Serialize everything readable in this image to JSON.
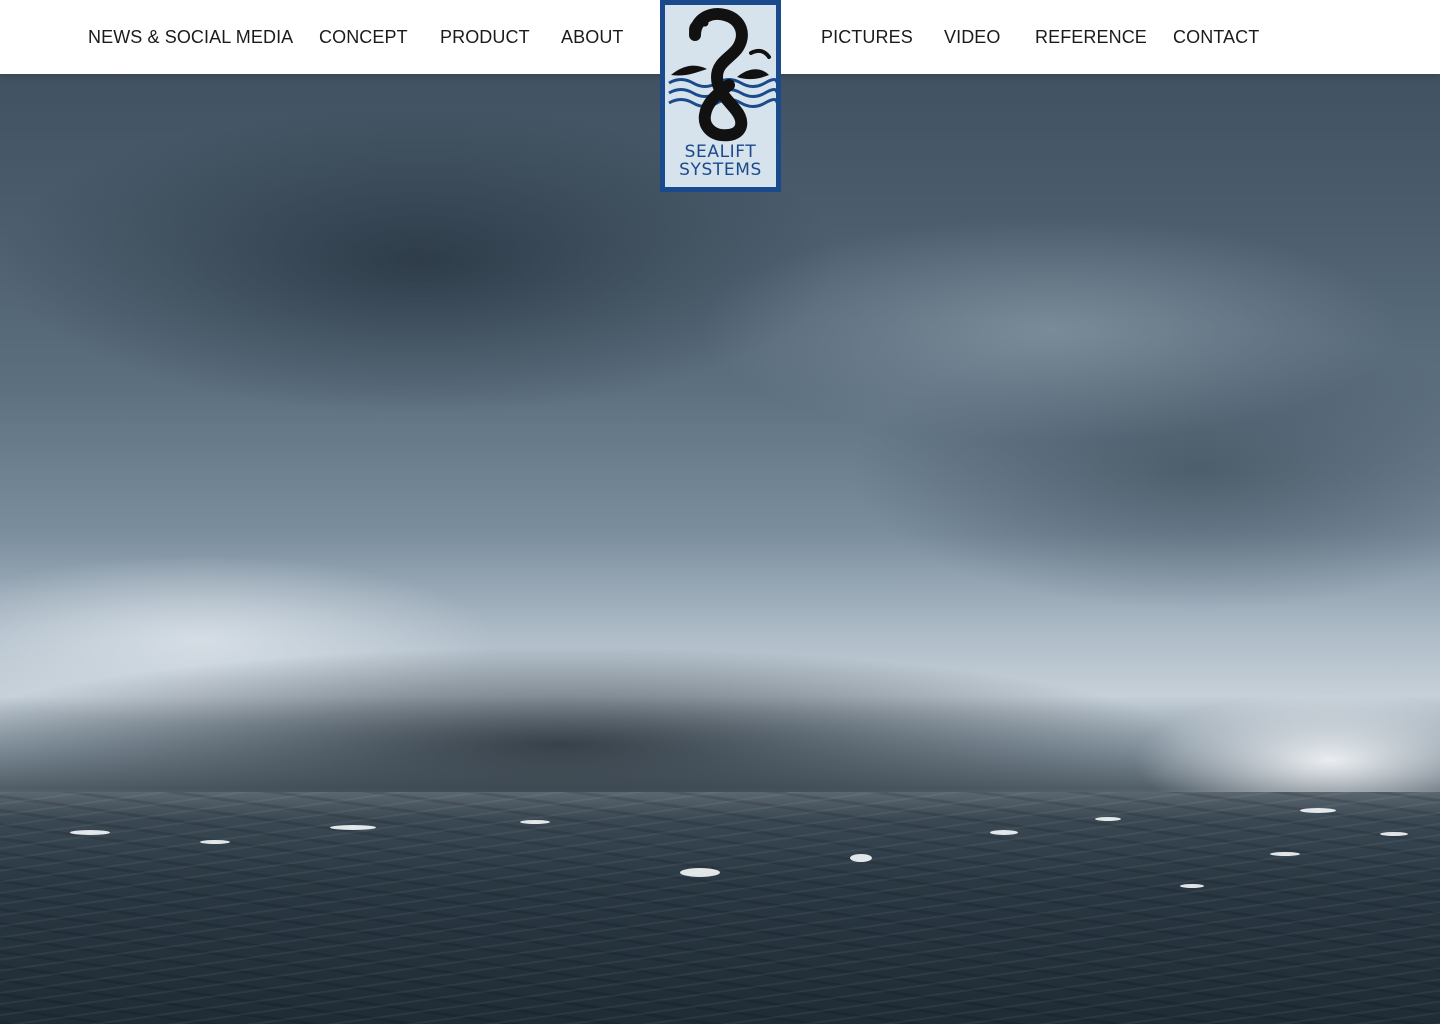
{
  "nav": {
    "left": [
      {
        "label": "NEWS & SOCIAL MEDIA"
      },
      {
        "label": "CONCEPT"
      },
      {
        "label": "PRODUCT"
      },
      {
        "label": "ABOUT"
      }
    ],
    "right": [
      {
        "label": "PICTURES"
      },
      {
        "label": "VIDEO"
      },
      {
        "label": "REFERENCE"
      },
      {
        "label": "CONTACT"
      }
    ]
  },
  "logo": {
    "line1": "SEALIFT",
    "line2": "SYSTEMS",
    "icon": "sea-serpent-logo-icon",
    "colors": {
      "frame": "#1a4a8c",
      "background": "#d6e3ec",
      "serpent": "#111111"
    }
  },
  "hero": {
    "image": "stormy-sea-photo"
  },
  "colors": {
    "navbar": "#ffffff",
    "nav_text": "#1b1b1b"
  }
}
